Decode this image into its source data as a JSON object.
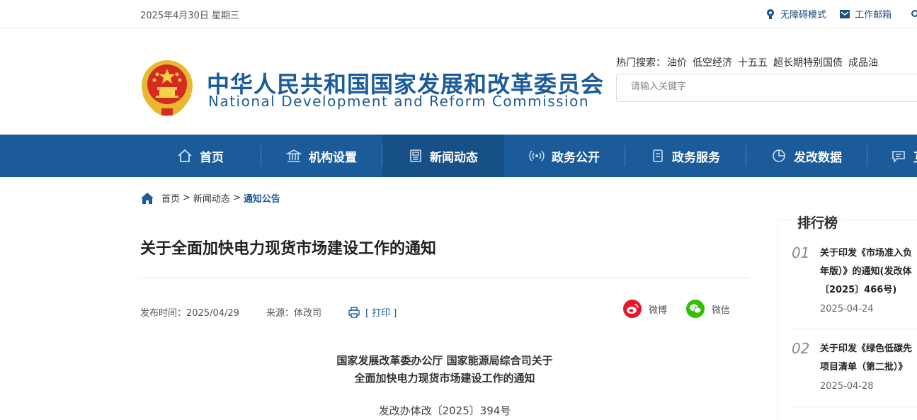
{
  "topbar": {
    "date": "2025年4月30日 星期三",
    "accessibility_label": "无障碍模式",
    "mail_label": "工作邮箱"
  },
  "header": {
    "site_name_cn": "中华人民共和国国家发展和改革委员会",
    "site_name_en": "National Development and Reform Commission",
    "hot_label": "热门搜索：",
    "hot_items": [
      "油价",
      "低空经济",
      "十五五",
      "超长期特别国债",
      "成品油"
    ],
    "search_placeholder": "请输入关键字"
  },
  "nav": {
    "items": [
      {
        "label": "首页",
        "icon": "home-icon"
      },
      {
        "label": "机构设置",
        "icon": "institution-icon"
      },
      {
        "label": "新闻动态",
        "icon": "news-icon"
      },
      {
        "label": "政务公开",
        "icon": "broadcast-icon"
      },
      {
        "label": "政务服务",
        "icon": "document-icon"
      },
      {
        "label": "发改数据",
        "icon": "pie-chart-icon"
      },
      {
        "label": "互",
        "icon": "chat-icon"
      }
    ],
    "active_index": 2
  },
  "breadcrumb": {
    "items": [
      "首页",
      "新闻动态",
      "通知公告"
    ],
    "separator": ">"
  },
  "article": {
    "title": "关于全面加快电力现货市场建设工作的通知",
    "publish_label": "发布时间：2025/04/29",
    "source_label": "来源：体改司",
    "print_label": "[ 打印 ]",
    "share_weibo": "微博",
    "share_wechat": "微信",
    "heading_line1": "国家发展改革委办公厅 国家能源局综合司关于",
    "heading_line2": "全面加快电力现货市场建设工作的通知",
    "doc_number": "发改办体改〔2025〕394号"
  },
  "ranking": {
    "title": "排行榜",
    "items": [
      {
        "num": "01",
        "lines": [
          "关于印发《市场准入负",
          "年版）》的通知(发改体",
          "〔2025〕466号)"
        ],
        "date": "2025-04-24"
      },
      {
        "num": "02",
        "lines": [
          "关于印发《绿色低碳先",
          "项目清单（第二批）》"
        ],
        "date": "2025-04-28"
      }
    ]
  },
  "colors": {
    "brand_blue": "#1b5b9a",
    "nav_active": "#174f87",
    "weibo_red": "#e6162d",
    "wechat_green": "#2dc100"
  }
}
